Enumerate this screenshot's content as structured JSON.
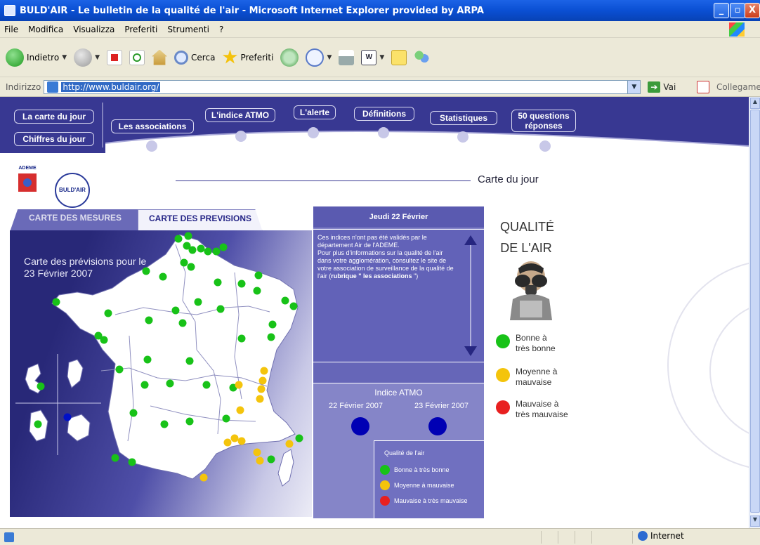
{
  "window": {
    "title": "BULD'AIR - Le bulletin de la qualité de l'air - Microsoft Internet Explorer provided by ARPA",
    "minimize": "_",
    "maximize": "▫",
    "close": "X"
  },
  "menu": [
    "File",
    "Modifica",
    "Visualizza",
    "Preferiti",
    "Strumenti",
    "?"
  ],
  "toolbar": {
    "back": "Indietro",
    "search": "Cerca",
    "favorites": "Preferiti"
  },
  "address": {
    "label": "Indirizzo",
    "url": "http://www.buldair.org/",
    "go": "Vai",
    "links": "Collegamenti"
  },
  "nav": {
    "carte_du_jour": "La carte du jour",
    "chiffres_du_jour": "Chiffres du jour",
    "associations": "Les associations",
    "indice_atmo": "L'indice ATMO",
    "alerte": "L'alerte",
    "definitions": "Définitions",
    "statistiques": "Statistiques",
    "questions_1": "50 questions",
    "questions_2": "réponses"
  },
  "header": {
    "ademe": "ADEME",
    "seal": "BULD'AIR",
    "page_title": "Carte du jour"
  },
  "map": {
    "tab_mesures": "CARTE DES MESURES",
    "tab_previsions": "CARTE DES PREVISIONS",
    "title_1": "Carte des prévisions pour le",
    "title_2": "23 Février 2007",
    "colors": {
      "good": "#18c218",
      "medium": "#f4c40c",
      "bad": "#e82020",
      "dom": "#0010c8"
    }
  },
  "info": {
    "date_header": "Jeudi 22 Février",
    "note_1": "Ces indices n'ont pas été validés par le département Air de l'ADEME.",
    "note_2": "Pour plus d'informations sur la qualité de l'air dans votre agglomération, consultez le site de votre association de surveillance de la qualité de l'air (",
    "note_bold": "rubrique \" les associations",
    "note_end": " \")",
    "atmo_title": "Indice ATMO",
    "date_left": "22 Février 2007",
    "date_right": "23 Février 2007",
    "legend_title": "Qualité de l'air",
    "legend": [
      "Bonne à très bonne",
      "Moyenne à mauvaise",
      "Mauvaise à très mauvaise"
    ]
  },
  "right": {
    "title_1": "QUALITÉ",
    "title_2": "DE L'AIR",
    "good_1": "Bonne à",
    "good_2": "très bonne",
    "medium_1": "Moyenne à",
    "medium_2": "mauvaise",
    "bad_1": "Mauvaise à",
    "bad_2": "très mauvaise"
  },
  "status": {
    "zone": "Internet"
  }
}
